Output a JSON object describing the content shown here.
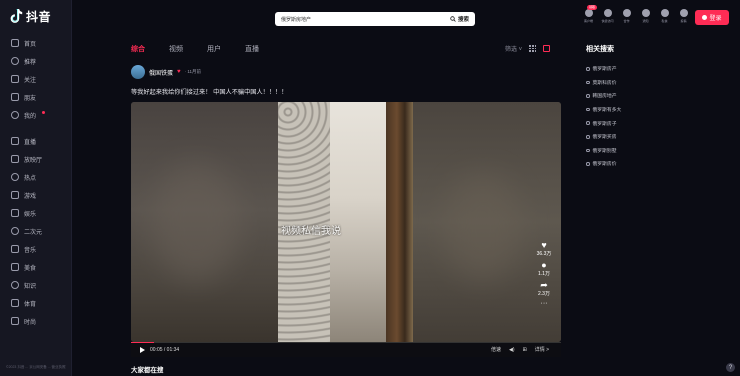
{
  "logo": {
    "text": "抖音"
  },
  "sidebar": {
    "items": [
      {
        "label": "首页",
        "icon": "home-icon"
      },
      {
        "label": "推荐",
        "icon": "thumb-icon"
      },
      {
        "label": "关注",
        "icon": "person-icon"
      },
      {
        "label": "朋友",
        "icon": "friends-icon"
      },
      {
        "label": "我的",
        "icon": "profile-icon"
      },
      {
        "label": "直播",
        "icon": "live-icon"
      },
      {
        "label": "放映厅",
        "icon": "screen-icon"
      },
      {
        "label": "热点",
        "icon": "fire-icon"
      },
      {
        "label": "游戏",
        "icon": "game-icon"
      },
      {
        "label": "娱乐",
        "icon": "entertainment-icon"
      },
      {
        "label": "二次元",
        "icon": "anime-icon"
      },
      {
        "label": "音乐",
        "icon": "music-icon"
      },
      {
        "label": "美食",
        "icon": "food-icon"
      },
      {
        "label": "知识",
        "icon": "book-icon"
      },
      {
        "label": "体育",
        "icon": "sports-icon"
      },
      {
        "label": "时尚",
        "icon": "fashion-icon"
      }
    ],
    "footer": "©2023 抖音 ... 京公网安备 ... 营业执照"
  },
  "search": {
    "value": "俄罗斯房地产",
    "button_label": "搜索"
  },
  "top_icons": [
    {
      "label": "客户端",
      "badge": "领取"
    },
    {
      "label": "快捷访问"
    },
    {
      "label": "合作"
    },
    {
      "label": "通知"
    },
    {
      "label": "私信"
    },
    {
      "label": "投稿"
    }
  ],
  "login_label": "登录",
  "tabs": [
    "综合",
    "视频",
    "用户",
    "直播"
  ],
  "active_tab": "综合",
  "filter_label": "筛选",
  "post": {
    "author": "俄国铁蛋",
    "date": "· 11月前",
    "caption": "等我好起来我给你们接过来！ 中国人不骗中国人！！！！",
    "watermark": "视频私信我说",
    "likes": "36.3万",
    "comments": "1.1万",
    "shares": "2.3万",
    "more": "···",
    "time": "00:05 / 01:34",
    "controls": {
      "speed": "倍速",
      "related": "详情 >"
    }
  },
  "others_heading": "大家都在搜",
  "related": {
    "title": "相关搜索",
    "items": [
      "俄罗斯房产",
      "莫斯科房价",
      "韩国房地产",
      "俄罗斯有多大",
      "俄罗斯房子",
      "俄罗斯买房",
      "俄罗斯别墅",
      "俄罗斯房价"
    ]
  },
  "help_label": "?",
  "colors": {
    "accent": "#fe2c55",
    "bg": "#0b0c14",
    "sidebar": "#161722"
  },
  "progress_fraction": 0.053
}
